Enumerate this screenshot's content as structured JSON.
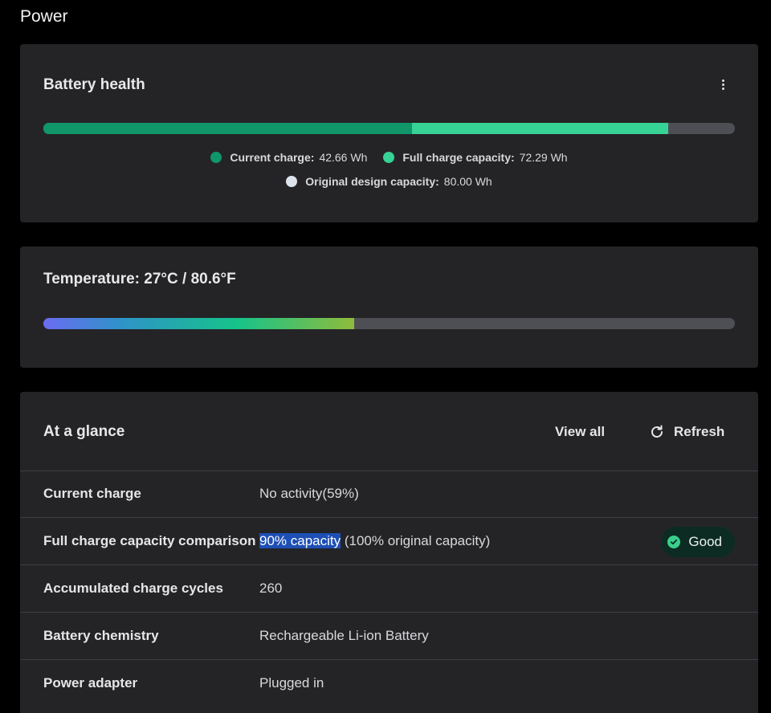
{
  "page": {
    "title": "Power"
  },
  "battery_health": {
    "title": "Battery health",
    "more_icon": "more-vertical-icon",
    "current_charge_wh": 42.66,
    "full_charge_capacity_wh": 72.29,
    "design_capacity_wh": 80.0,
    "legend": {
      "current_label": "Current charge:",
      "current_value": "42.66 Wh",
      "full_label": "Full charge capacity:",
      "full_value": "72.29 Wh",
      "design_label": "Original design capacity:",
      "design_value": "80.00 Wh"
    },
    "colors": {
      "current": "#109668",
      "full": "#37d295",
      "design": "#dde3ec",
      "track": "#4e4f55"
    }
  },
  "temperature": {
    "title": "Temperature:  27°C / 80.6°F",
    "level_fraction": 0.45
  },
  "at_a_glance": {
    "title": "At a glance",
    "view_all_label": "View all",
    "refresh_label": "Refresh",
    "refresh_icon": "refresh-icon",
    "rows": [
      {
        "label": "Current charge",
        "value": "No activity(59%)"
      },
      {
        "label": "Full charge capacity comparison",
        "value_highlight": "90% capacity",
        "value_rest": " (100% original capacity)",
        "badge": "Good",
        "badge_icon": "check-circle-icon"
      },
      {
        "label": "Accumulated charge cycles",
        "value": "260"
      },
      {
        "label": "Battery chemistry",
        "value": "Rechargeable Li-ion Battery"
      },
      {
        "label": "Power adapter",
        "value": "Plugged in"
      }
    ]
  }
}
